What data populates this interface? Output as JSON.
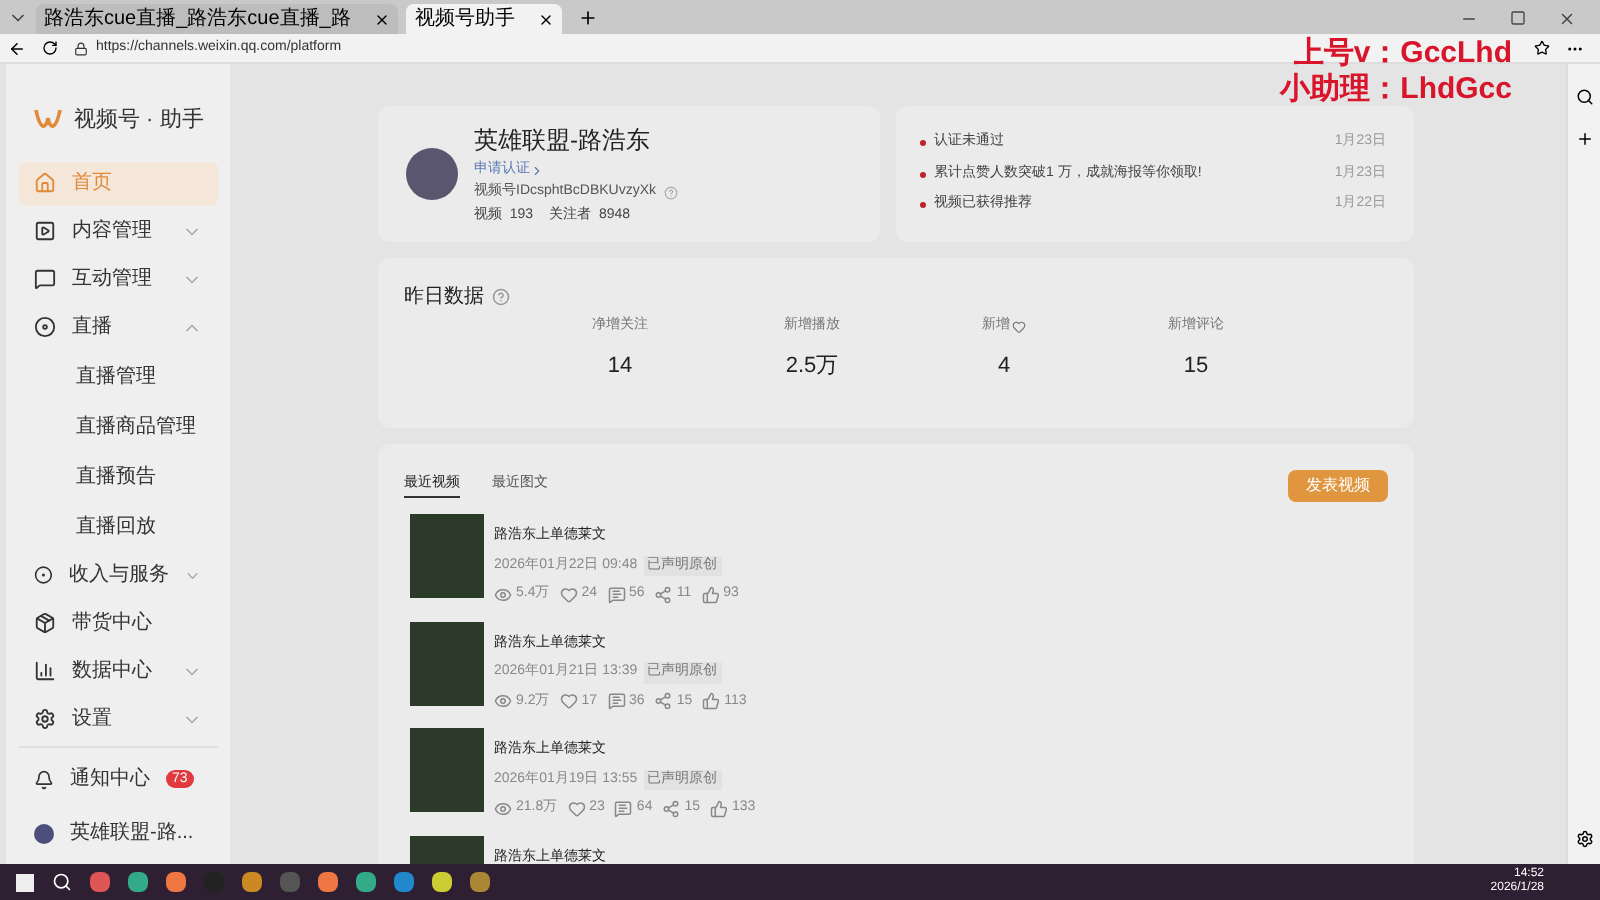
{
  "browser": {
    "tabs": [
      {
        "title": "路浩东cue直播_路浩东cue直播_路",
        "selected": false
      },
      {
        "title": "视频号助手",
        "selected": true
      }
    ],
    "url": "https://channels.weixin.qq.com/platform"
  },
  "overlay_text": [
    "上号v：GccLhd",
    "小助理：LhdGcc"
  ],
  "sidebar": {
    "brand": "视频号 · 助手",
    "items": [
      {
        "kind": "home",
        "label": "首页",
        "selected": true
      },
      {
        "kind": "content",
        "label": "内容管理",
        "selected": false,
        "expanded": false
      },
      {
        "kind": "interact",
        "label": "互动管理",
        "selected": false,
        "expanded": false
      },
      {
        "kind": "live",
        "label": "直播",
        "selected": false,
        "expanded": true,
        "children": [
          {
            "label": "直播管理",
            "selected": false
          },
          {
            "label": "直播商品管理",
            "selected": false
          },
          {
            "label": "直播预告",
            "selected": false
          },
          {
            "label": "直播回放",
            "selected": false
          }
        ]
      },
      {
        "kind": "income",
        "label": "收入与服务",
        "selected": false,
        "expanded": false
      },
      {
        "kind": "goods",
        "label": "带货中心",
        "selected": false
      },
      {
        "kind": "data",
        "label": "数据中心",
        "selected": false,
        "expanded": false
      },
      {
        "kind": "settings",
        "label": "设置",
        "selected": false,
        "expanded": false
      }
    ],
    "notifications": {
      "label": "通知中心",
      "badge": "73"
    },
    "account": {
      "name": "英雄联盟-路..."
    }
  },
  "profile": {
    "name": "英雄联盟-路浩东",
    "verify": "申请认证",
    "id": "视频号IDcsphtBcDBKUvzyXk",
    "stats": [
      "视频  193",
      "关注者  8948"
    ]
  },
  "notices": [
    {
      "text": "认证未通过",
      "date": "1月23日"
    },
    {
      "text": "累计点赞人数突破1 万，成就海报等你领取!",
      "date": "1月23日"
    },
    {
      "text": "视频已获得推荐",
      "date": "1月22日"
    }
  ],
  "yesterday": {
    "title": "昨日数据",
    "metrics": [
      {
        "kind": "text",
        "label": "净增关注",
        "value": "14"
      },
      {
        "kind": "text",
        "label": "新增播放",
        "value": "2.5万"
      },
      {
        "kind": "heart",
        "label": "新增",
        "value": "4"
      },
      {
        "kind": "text",
        "label": "新增评论",
        "value": "15"
      }
    ]
  },
  "videos": {
    "tabs": [
      {
        "label": "最近视频",
        "selected": true
      },
      {
        "label": "最近图文",
        "selected": false
      }
    ],
    "publish": "发表视频",
    "items": [
      {
        "title": "路浩东上单德莱文",
        "time": "2026年01月22日 09:48",
        "tag": "已声明原创",
        "views": "5.4万",
        "hearts": "24",
        "comments": "56",
        "shares": "11",
        "likes": "93"
      },
      {
        "title": "路浩东上单德莱文",
        "time": "2026年01月21日 13:39",
        "tag": "已声明原创",
        "views": "9.2万",
        "hearts": "17",
        "comments": "36",
        "shares": "15",
        "likes": "113"
      },
      {
        "title": "路浩东上单德莱文",
        "time": "2026年01月19日 13:55",
        "tag": "已声明原创",
        "views": "21.8万",
        "hearts": "23",
        "comments": "64",
        "shares": "15",
        "likes": "133"
      },
      {
        "title": "路浩东上单德莱文"
      }
    ]
  },
  "taskbar": {
    "time": "14:52",
    "date": "2026/1/28"
  }
}
